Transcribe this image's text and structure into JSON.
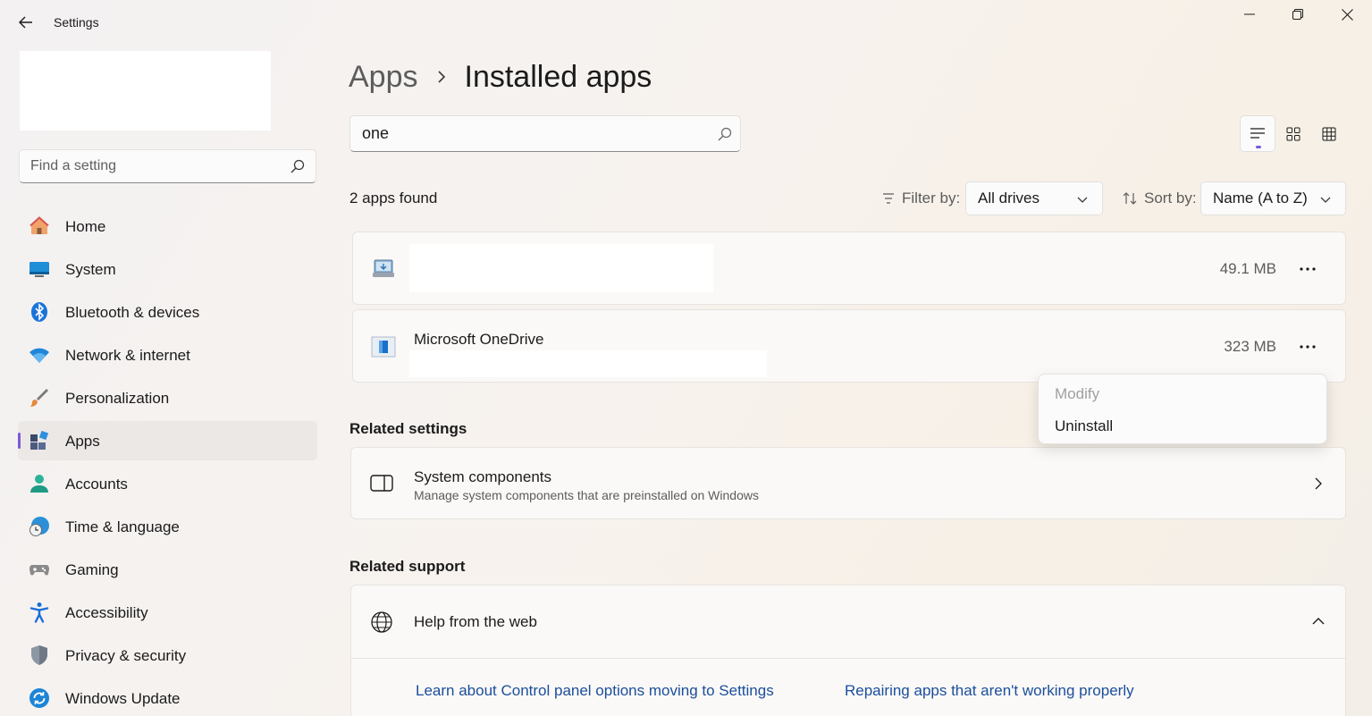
{
  "window": {
    "title": "Settings",
    "controls": [
      "minimize",
      "restore",
      "close"
    ]
  },
  "sidebar": {
    "search_placeholder": "Find a setting",
    "items": [
      {
        "label": "Home",
        "icon": "home-icon"
      },
      {
        "label": "System",
        "icon": "system-icon"
      },
      {
        "label": "Bluetooth & devices",
        "icon": "bluetooth-icon"
      },
      {
        "label": "Network & internet",
        "icon": "wifi-icon"
      },
      {
        "label": "Personalization",
        "icon": "brush-icon"
      },
      {
        "label": "Apps",
        "icon": "apps-icon",
        "active": true
      },
      {
        "label": "Accounts",
        "icon": "account-icon"
      },
      {
        "label": "Time & language",
        "icon": "clock-globe-icon"
      },
      {
        "label": "Gaming",
        "icon": "gamepad-icon"
      },
      {
        "label": "Accessibility",
        "icon": "accessibility-icon"
      },
      {
        "label": "Privacy & security",
        "icon": "shield-icon"
      },
      {
        "label": "Windows Update",
        "icon": "update-icon"
      }
    ],
    "active_color": "#7c5bd6"
  },
  "main": {
    "breadcrumb": {
      "parent": "Apps",
      "current": "Installed apps"
    },
    "search_value": "one",
    "apps_found": "2 apps found",
    "filter": {
      "label": "Filter by:",
      "value": "All drives"
    },
    "sort": {
      "label": "Sort by:",
      "value": "Name (A to Z)"
    },
    "apps": [
      {
        "name": "",
        "size": "49.1 MB",
        "icon": "installer-icon"
      },
      {
        "name": "Microsoft OneDrive",
        "size": "323 MB",
        "icon": "onedrive-icon"
      }
    ],
    "context_menu": {
      "modify": "Modify",
      "uninstall": "Uninstall"
    },
    "related_settings": {
      "title": "Related settings",
      "system_components": {
        "name": "System components",
        "description": "Manage system components that are preinstalled on Windows"
      }
    },
    "related_support": {
      "title": "Related support",
      "help_title": "Help from the web",
      "links": [
        "Learn about Control panel options moving to Settings",
        "Repairing apps that aren't working properly"
      ]
    }
  }
}
